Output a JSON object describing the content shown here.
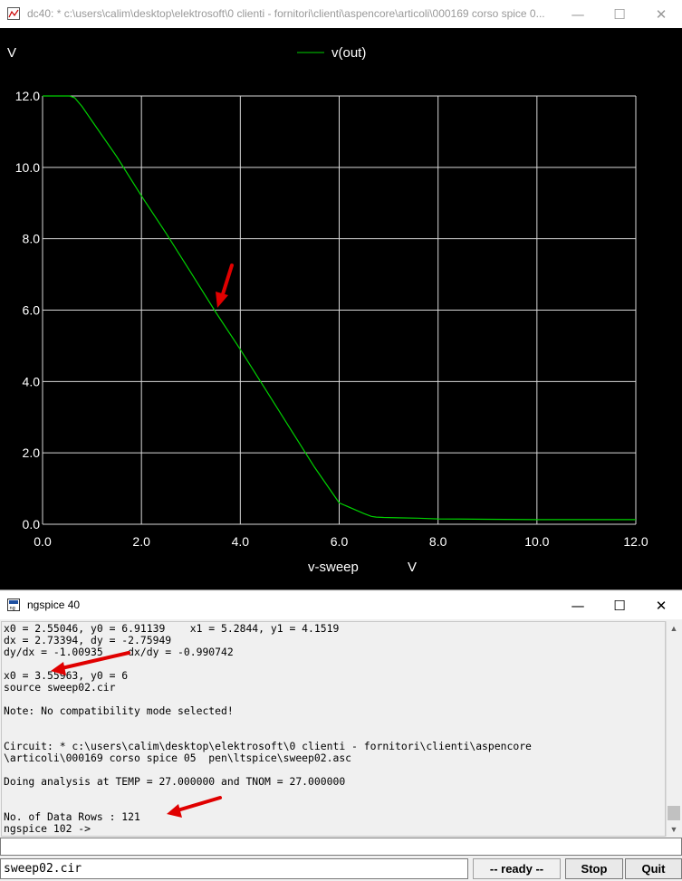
{
  "plot_window": {
    "title": "dc40: * c:\\users\\calim\\desktop\\elektrosoft\\0 clienti - fornitori\\clienti\\aspencore\\articoli\\000169 corso spice 0...",
    "minimize": "—",
    "maximize": "☐",
    "close": "✕"
  },
  "chart_data": {
    "type": "line",
    "ylabel": "V",
    "xlabel": "v-sweep",
    "xunit": "V",
    "xlim": [
      0,
      12
    ],
    "ylim": [
      0,
      12
    ],
    "x_ticks": [
      "0.0",
      "2.0",
      "4.0",
      "6.0",
      "8.0",
      "10.0",
      "12.0"
    ],
    "y_ticks": [
      "0.0",
      "2.0",
      "4.0",
      "6.0",
      "8.0",
      "10.0",
      "12.0"
    ],
    "grid": true,
    "legend_position": "top-center",
    "colors": {
      "background": "#000000",
      "series": "#00d000",
      "grid": "#d8d8d8"
    },
    "series": [
      {
        "name": "v(out)",
        "x": [
          0.0,
          0.3,
          0.55,
          0.65,
          0.8,
          1.0,
          1.5,
          2.0,
          2.5,
          3.0,
          3.5,
          4.0,
          4.5,
          5.0,
          5.5,
          6.0,
          6.5,
          6.65,
          6.75,
          6.9,
          7.2,
          7.6,
          8.0,
          9.0,
          10.0,
          11.0,
          12.0
        ],
        "y": [
          12.0,
          12.0,
          12.0,
          11.95,
          11.7,
          11.3,
          10.3,
          9.2,
          8.15,
          7.05,
          5.95,
          4.9,
          3.8,
          2.7,
          1.6,
          0.6,
          0.3,
          0.22,
          0.2,
          0.19,
          0.18,
          0.17,
          0.15,
          0.14,
          0.13,
          0.13,
          0.13
        ]
      }
    ]
  },
  "console_window": {
    "title": "ngspice 40",
    "minimize": "—",
    "maximize": "☐",
    "close": "✕",
    "output_lines": [
      "x0 = 2.55046, y0 = 6.91139    x1 = 5.2844, y1 = 4.1519",
      "dx = 2.73394, dy = -2.75949",
      "dy/dx = -1.00935    dx/dy = -0.990742",
      "",
      "x0 = 3.55963, y0 = 6",
      "source sweep02.cir",
      "",
      "Note: No compatibility mode selected!",
      "",
      "",
      "Circuit: * c:\\users\\calim\\desktop\\elektrosoft\\0 clienti - fornitori\\clienti\\aspencore",
      "\\articoli\\000169 corso spice 05  pen\\ltspice\\sweep02.asc",
      "",
      "Doing analysis at TEMP = 27.000000 and TNOM = 27.000000",
      "",
      "",
      "No. of Data Rows : 121",
      "ngspice 102 ->"
    ],
    "command_value": "",
    "status": {
      "filename": "sweep02.cir",
      "state": "-- ready --",
      "stop_label": "Stop",
      "quit_label": "Quit"
    }
  }
}
